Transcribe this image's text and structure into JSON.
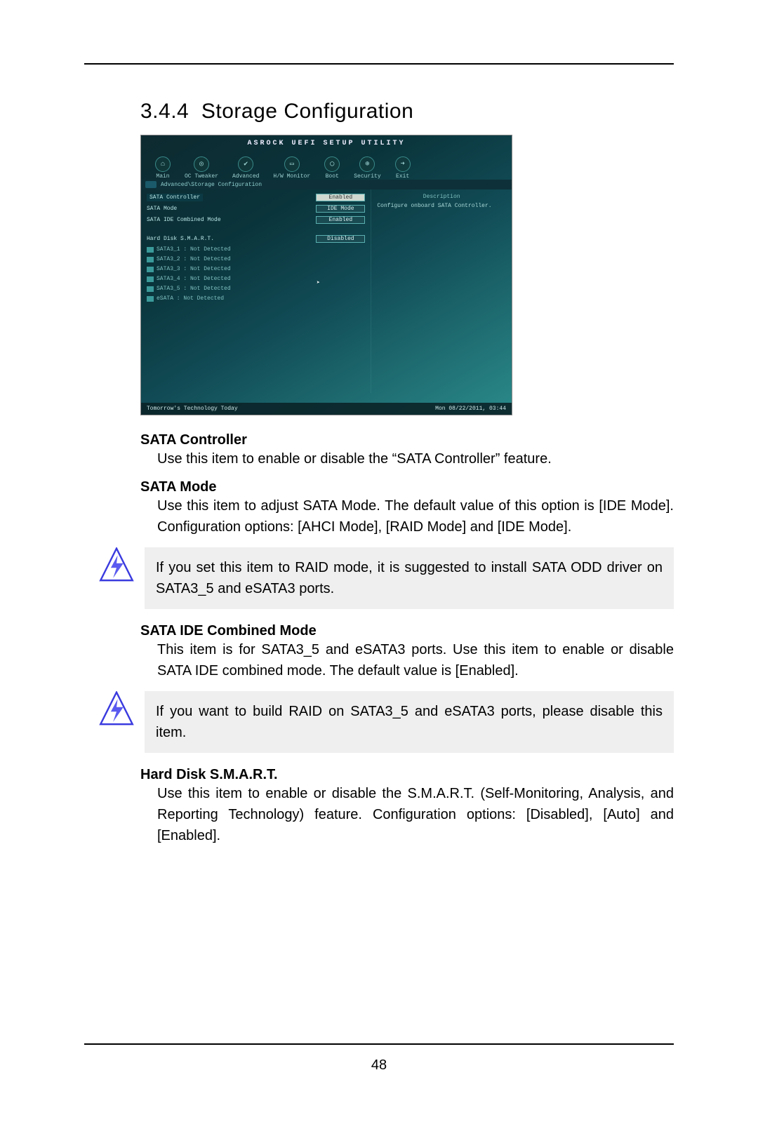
{
  "section_number": "3.4.4",
  "section_title": "Storage Configuration",
  "page_number": "48",
  "bios": {
    "title": "ASROCK UEFI SETUP UTILITY",
    "menu": [
      "Main",
      "OC Tweaker",
      "Advanced",
      "H/W Monitor",
      "Boot",
      "Security",
      "Exit"
    ],
    "breadcrumb": "Advanced\\Storage Configuration",
    "rows": [
      {
        "label": "SATA Controller",
        "value": "Enabled",
        "selected": true
      },
      {
        "label": "SATA Mode",
        "value": "IDE Mode"
      },
      {
        "label": "SATA IDE Combined Mode",
        "value": "Enabled"
      },
      {
        "label": "Hard Disk S.M.A.R.T.",
        "value": "Disabled",
        "gap": true
      }
    ],
    "ports": [
      "SATA3_1 : Not Detected",
      "SATA3_2 : Not Detected",
      "SATA3_3 : Not Detected",
      "SATA3_4 : Not Detected",
      "SATA3_5 : Not Detected",
      "eSATA   : Not Detected"
    ],
    "right_title": "Description",
    "right_body": "Configure onboard SATA Controller.",
    "footer_left": "Tomorrow's Technology Today",
    "footer_right": "Mon 08/22/2011, 03:44"
  },
  "items": [
    {
      "title": "SATA Controller",
      "desc": "Use this item to enable or disable the “SATA Controller” feature."
    },
    {
      "title": "SATA Mode",
      "desc": "Use this item to adjust SATA Mode. The default value of this option is [IDE Mode]. Configuration options: [AHCI Mode], [RAID Mode] and [IDE Mode]."
    }
  ],
  "note1": "If you set this item to RAID mode, it is suggested to install SATA ODD driver on SATA3_5 and eSATA3 ports.",
  "items2": [
    {
      "title": "SATA IDE Combined Mode",
      "desc": "This item is for SATA3_5 and eSATA3 ports. Use this item to enable or disable SATA IDE combined mode. The default value is [Enabled]."
    }
  ],
  "note2": "If you want to build RAID on SATA3_5 and eSATA3 ports, please disable this item.",
  "items3": [
    {
      "title": "Hard Disk S.M.A.R.T.",
      "desc": "Use this item to enable or disable the S.M.A.R.T. (Self-Monitoring, Analysis, and Reporting Technology) feature. Configuration options: [Disabled], [Auto] and [Enabled]."
    }
  ]
}
